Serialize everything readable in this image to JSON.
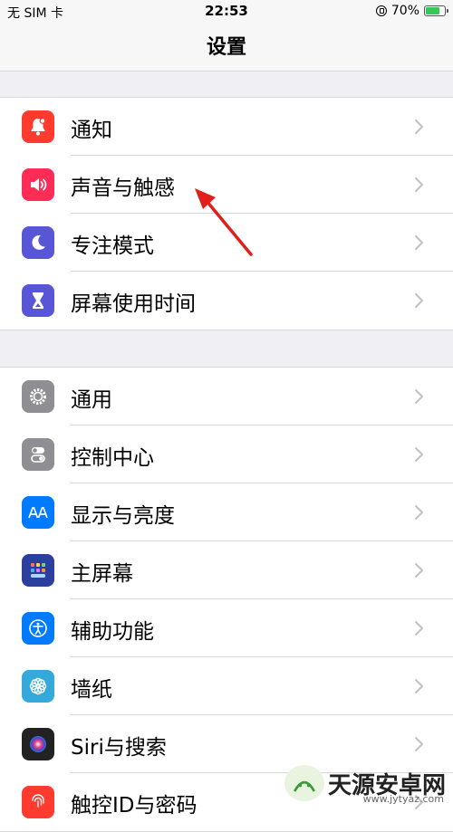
{
  "status_bar": {
    "carrier": "无 SIM 卡",
    "time": "22:53",
    "battery": "70%"
  },
  "nav": {
    "title": "设置"
  },
  "groups": [
    {
      "items": [
        {
          "label": "通知",
          "icon": "bell-icon",
          "color": "#ff3b30"
        },
        {
          "label": "声音与触感",
          "icon": "speaker-icon",
          "color": "#ff2d55"
        },
        {
          "label": "专注模式",
          "icon": "moon-icon",
          "color": "#5856d6"
        },
        {
          "label": "屏幕使用时间",
          "icon": "hourglass-icon",
          "color": "#5856d6"
        }
      ]
    },
    {
      "items": [
        {
          "label": "通用",
          "icon": "gear-icon",
          "color": "#8e8e93"
        },
        {
          "label": "控制中心",
          "icon": "toggles-icon",
          "color": "#8e8e93"
        },
        {
          "label": "显示与亮度",
          "icon": "text-size-icon",
          "color": "#007aff"
        },
        {
          "label": "主屏幕",
          "icon": "app-grid-icon",
          "color": "#2c3e9e"
        },
        {
          "label": "辅助功能",
          "icon": "accessibility-icon",
          "color": "#007aff"
        },
        {
          "label": "墙纸",
          "icon": "flower-icon",
          "color": "#34aadc"
        },
        {
          "label": "Siri与搜索",
          "icon": "siri-icon",
          "color": "#222222"
        },
        {
          "label": "触控ID与密码",
          "icon": "fingerprint-icon",
          "color": "#ff3b30"
        }
      ]
    }
  ],
  "watermark": {
    "name": "天源安卓网",
    "url": "www.jytyaz.com"
  }
}
